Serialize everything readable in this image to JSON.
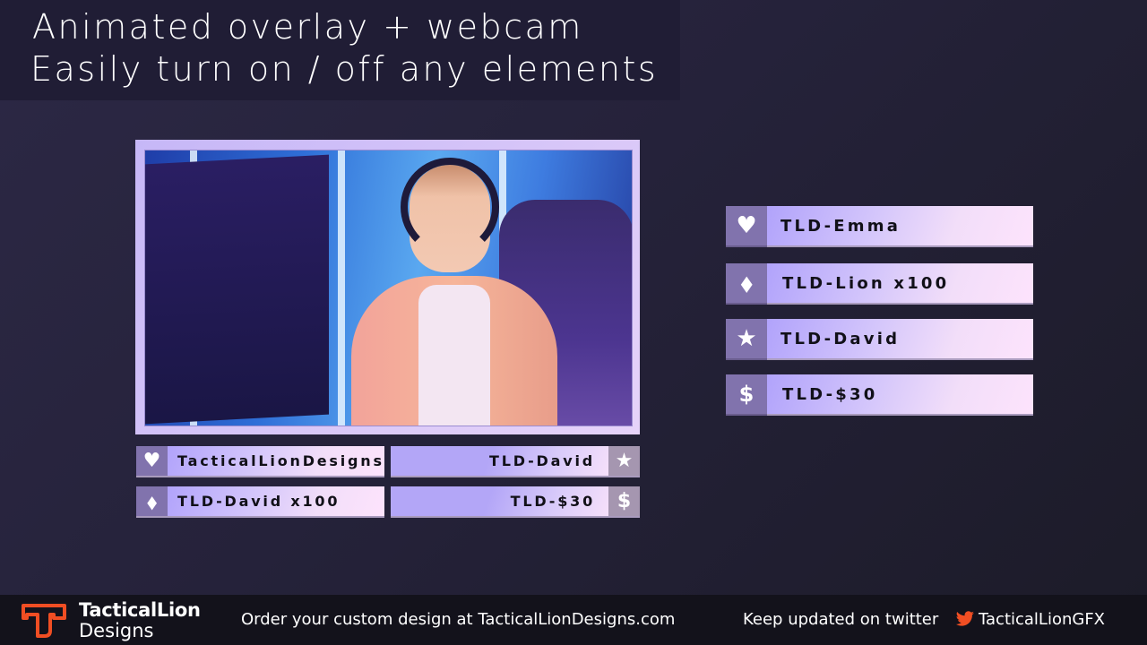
{
  "header": {
    "line1": "Animated overlay + webcam",
    "line2": "Easily turn on / off any elements"
  },
  "alerts_large": [
    {
      "icon": "heart-icon",
      "glyph": "♥",
      "label": "TLD-Emma"
    },
    {
      "icon": "diamond-icon",
      "glyph": "◆",
      "label": "TLD-Lion x100"
    },
    {
      "icon": "star-icon",
      "glyph": "★",
      "label": "TLD-David"
    },
    {
      "icon": "dollar-icon",
      "glyph": "$",
      "label": "TLD-$30"
    }
  ],
  "alerts_small_left": [
    {
      "icon": "heart-icon",
      "glyph": "♥",
      "label": "TacticalLionDesigns"
    },
    {
      "icon": "diamond-icon",
      "glyph": "◆",
      "label": "TLD-David x100"
    }
  ],
  "alerts_small_right": [
    {
      "icon": "star-icon",
      "glyph": "★",
      "label": "TLD-David"
    },
    {
      "icon": "dollar-icon",
      "glyph": "$",
      "label": "TLD-$30"
    }
  ],
  "webcam": {
    "description": "Webcam frame showing a smiling woman with a headset at a computer"
  },
  "footer": {
    "brand_name": "TacticalLion",
    "brand_sub": "Designs",
    "order_text": "Order your custom design at TacticalLionDesigns.com",
    "twitter_text": "Keep updated on twitter",
    "twitter_handle": "TacticalLionGFX",
    "accent_color": "#f04e23"
  }
}
